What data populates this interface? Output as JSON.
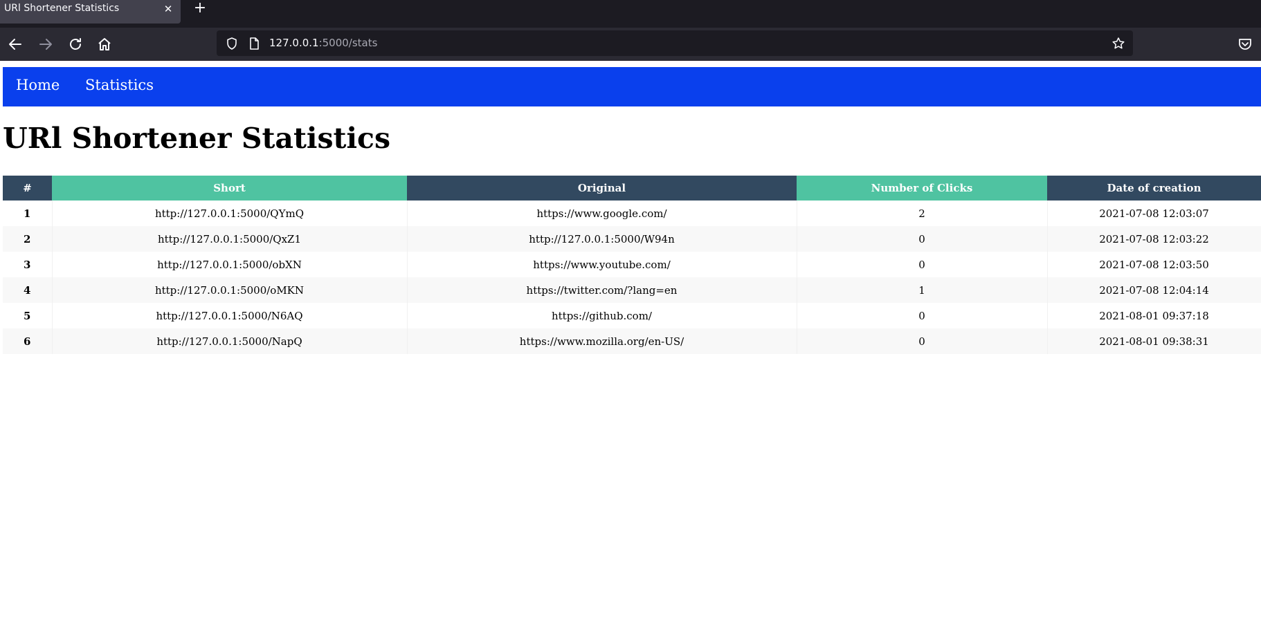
{
  "browser": {
    "tab_title": "URl Shortener Statistics",
    "url_host": "127.0.0.1",
    "url_path": ":5000/stats"
  },
  "nav": {
    "home": "Home",
    "statistics": "Statistics"
  },
  "page": {
    "title": "URl Shortener Statistics"
  },
  "table": {
    "headers": [
      "#",
      "Short",
      "Original",
      "Number of Clicks",
      "Date of creation"
    ],
    "rows": [
      {
        "id": "1",
        "short": "http://127.0.0.1:5000/QYmQ",
        "original": "https://www.google.com/",
        "clicks": "2",
        "date": "2021-07-08 12:03:07"
      },
      {
        "id": "2",
        "short": "http://127.0.0.1:5000/QxZ1",
        "original": "http://127.0.0.1:5000/W94n",
        "clicks": "0",
        "date": "2021-07-08 12:03:22"
      },
      {
        "id": "3",
        "short": "http://127.0.0.1:5000/obXN",
        "original": "https://www.youtube.com/",
        "clicks": "0",
        "date": "2021-07-08 12:03:50"
      },
      {
        "id": "4",
        "short": "http://127.0.0.1:5000/oMKN",
        "original": "https://twitter.com/?lang=en",
        "clicks": "1",
        "date": "2021-07-08 12:04:14"
      },
      {
        "id": "5",
        "short": "http://127.0.0.1:5000/N6AQ",
        "original": "https://github.com/",
        "clicks": "0",
        "date": "2021-08-01 09:37:18"
      },
      {
        "id": "6",
        "short": "http://127.0.0.1:5000/NapQ",
        "original": "https://www.mozilla.org/en-US/",
        "clicks": "0",
        "date": "2021-08-01 09:38:31"
      }
    ]
  },
  "colors": {
    "nav_bg": "#0a40ed",
    "header_dark": "#324960",
    "header_green": "#4fc3a1"
  }
}
